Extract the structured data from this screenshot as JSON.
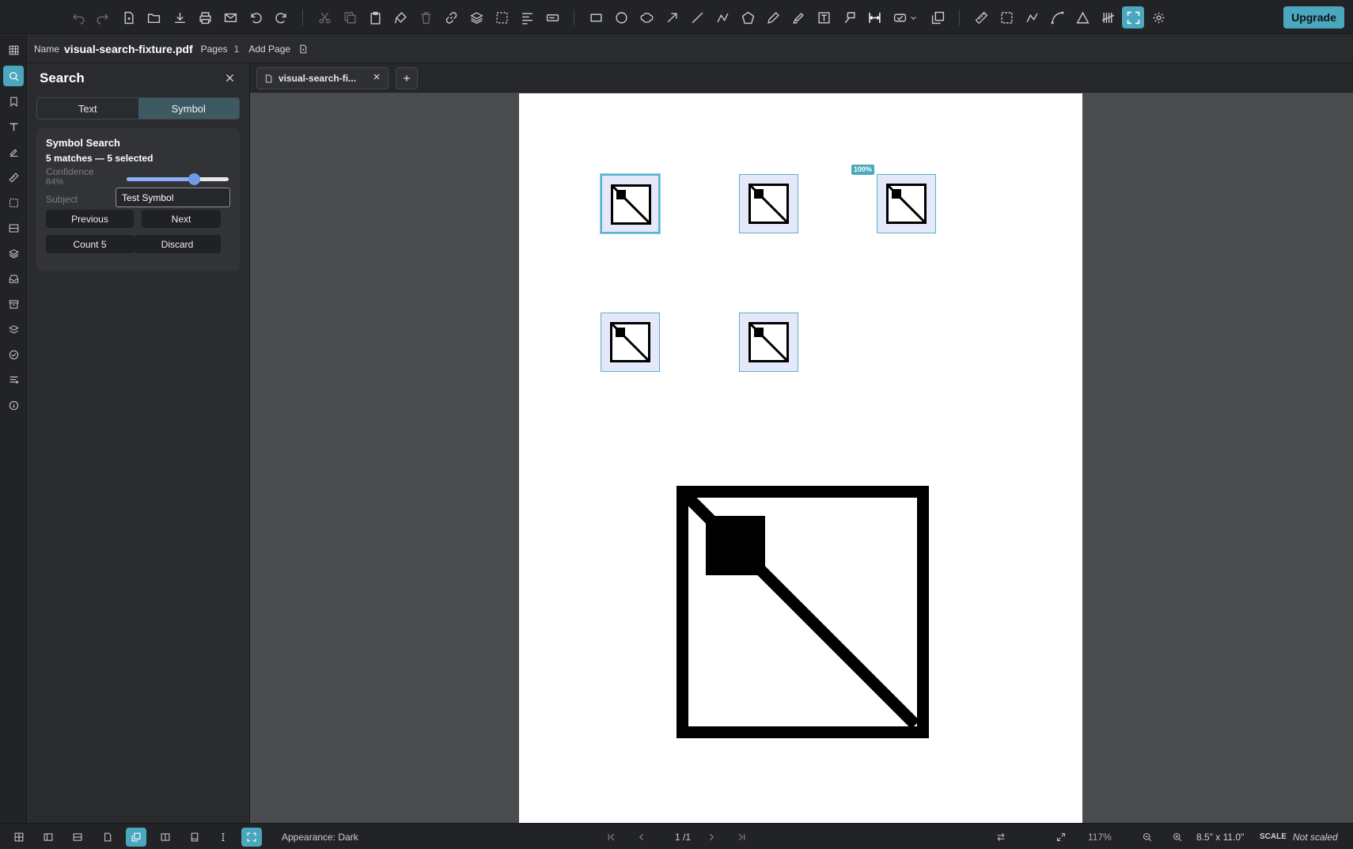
{
  "toolbar": {
    "upgrade_label": "Upgrade",
    "tools": [
      "undo-icon",
      "redo-icon",
      "new-file-icon",
      "open-folder-icon",
      "download-icon",
      "print-icon",
      "mail-icon",
      "rotate-ccw-icon",
      "rotate-cw-icon",
      "cut-icon",
      "copy-icon",
      "paste-icon",
      "format-brush-icon",
      "trash-icon",
      "link-icon",
      "layers-icon",
      "select-box-icon",
      "align-icon",
      "text-field-icon",
      "rectangle-icon",
      "ellipse-icon",
      "cloud-icon",
      "arrow-icon",
      "line-icon",
      "polyline-icon",
      "polygon-icon",
      "pen-icon",
      "highlighter-icon",
      "text-box-icon",
      "callout-icon",
      "dimension-icon",
      "stamp-icon",
      "dropdown-icon",
      "image-icon",
      "measure-ruler-icon",
      "area-icon",
      "perimeter-icon",
      "arc-icon",
      "angle-icon",
      "count-icon",
      "fullscreen-icon",
      "settings-icon"
    ]
  },
  "rail": {
    "items": [
      "thumbnails-icon",
      "search-icon",
      "bookmarks-icon",
      "text-icon",
      "signature-icon",
      "measurements-icon",
      "markups-icon",
      "forms-icon",
      "layers-icon",
      "inbox-icon",
      "archive-icon",
      "stack-icon",
      "checklist-icon",
      "properties-icon",
      "info-icon"
    ]
  },
  "file": {
    "name_label": "Name",
    "name": "visual-search-fixture.pdf",
    "pages_label": "Pages",
    "pages": "1",
    "add_page_label": "Add Page"
  },
  "search": {
    "title": "Search",
    "tabs": [
      "Text",
      "Symbol"
    ],
    "active_tab": "Symbol",
    "card_title": "Symbol Search",
    "status": "5 matches — 5 selected",
    "confidence_label": "Confidence",
    "confidence_value": "84%",
    "confidence_fraction": 0.66,
    "subject_label": "Subject",
    "subject_value": "Test Symbol",
    "previous_label": "Previous",
    "next_label": "Next",
    "count_label": "Count 5",
    "discard_label": "Discard"
  },
  "document": {
    "tab_label": "visual-search-fi...",
    "match_badge": "100%",
    "match_count": 5
  },
  "status": {
    "appearance": "Appearance: Dark",
    "page_indicator": "1 /1",
    "zoom": "117%",
    "page_size": "8.5\" x 11.0\"",
    "scale_label": "SCALE",
    "scale_value": "Not scaled"
  },
  "colors": {
    "accent": "#4aa7bd",
    "match_fill": "#e4e8f8",
    "slider": "#6f9ae8"
  }
}
